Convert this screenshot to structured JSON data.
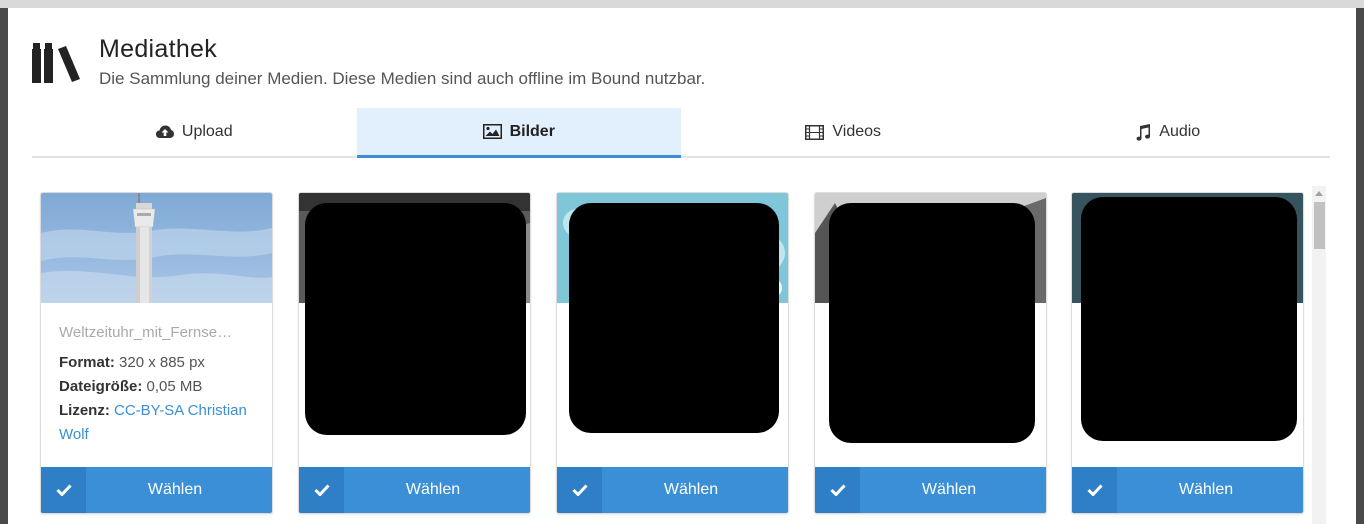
{
  "modal": {
    "title": "Mediathek",
    "subtitle": "Die Sammlung deiner Medien. Diese Medien sind auch offline im Bound nutzbar."
  },
  "tabs": [
    {
      "label": "Upload",
      "icon": "cloud-upload-icon"
    },
    {
      "label": "Bilder",
      "icon": "image-icon",
      "active": true
    },
    {
      "label": "Videos",
      "icon": "film-icon"
    },
    {
      "label": "Audio",
      "icon": "music-note-icon"
    }
  ],
  "cards": [
    {
      "filename": "Weltzeituhr_mit_Fernse…",
      "format_label": "Format:",
      "format_value": "320 x 885 px",
      "size_label": "Dateigröße:",
      "size_value": "0,05 MB",
      "license_label": "Lizenz:",
      "license_value": "CC-BY-SA Christian Wolf",
      "choose_label": "Wählen"
    },
    {
      "choose_label": "Wählen"
    },
    {
      "choose_label": "Wählen"
    },
    {
      "choose_label": "Wählen"
    },
    {
      "choose_label": "Wählen"
    }
  ],
  "colors": {
    "accent": "#3a8fd6",
    "accent_dark": "#2f7fc6",
    "tab_active_bg": "#e1f0fc"
  }
}
